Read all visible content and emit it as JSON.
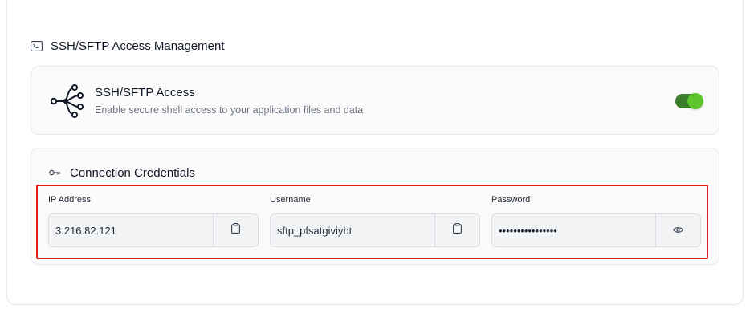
{
  "section": {
    "title": "SSH/SFTP Access Management",
    "icon": "terminal-icon"
  },
  "access": {
    "title": "SSH/SFTP Access",
    "description": "Enable secure shell access to your application files and data",
    "icon": "network-icon",
    "enabled": true,
    "toggle_color": "#5cc52c"
  },
  "credentials": {
    "title": "Connection Credentials",
    "icon": "key-icon",
    "fields": [
      {
        "label": "IP Address",
        "value": "3.216.82.121",
        "action_icon": "clipboard-icon"
      },
      {
        "label": "Username",
        "value": "sftp_pfsatgiviybt",
        "action_icon": "clipboard-icon"
      },
      {
        "label": "Password",
        "value": "••••••••••••••••",
        "action_icon": "eye-icon"
      }
    ]
  },
  "highlight_color": "#e11d1d"
}
